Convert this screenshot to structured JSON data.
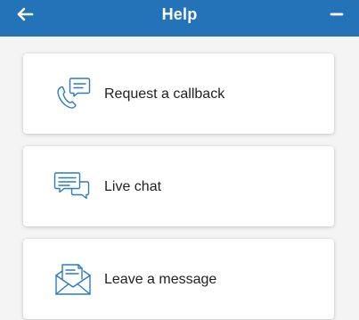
{
  "header": {
    "title": "Help",
    "back_icon": "arrow-left-icon",
    "minimize_icon": "minus-icon",
    "background_color": "#2472b8"
  },
  "options": [
    {
      "label": "Request a callback",
      "icon": "phone-callback-icon"
    },
    {
      "label": "Live chat",
      "icon": "chat-bubbles-icon"
    },
    {
      "label": "Leave a message",
      "icon": "envelope-message-icon"
    }
  ],
  "accent_color": "#2a7bc0"
}
